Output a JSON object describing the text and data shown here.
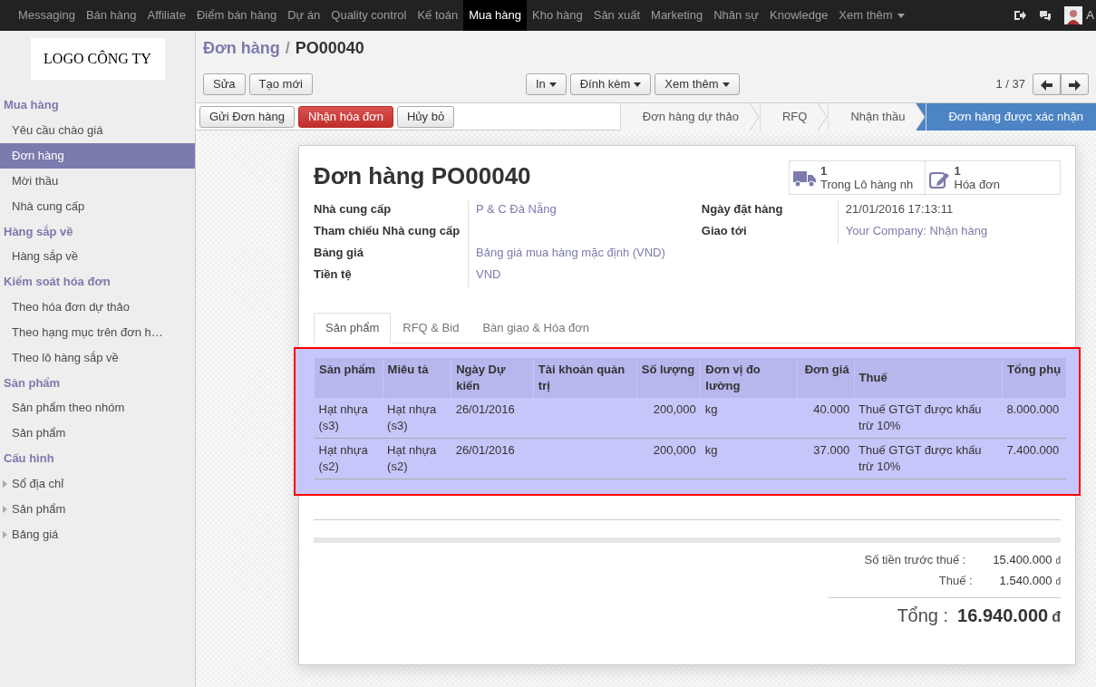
{
  "topbar": {
    "apps": [
      {
        "label": "Messaging",
        "selected": false
      },
      {
        "label": "Bán hàng",
        "selected": false
      },
      {
        "label": "Affiliate",
        "selected": false
      },
      {
        "label": "Điểm bán hàng",
        "selected": false
      },
      {
        "label": "Dự án",
        "selected": false
      },
      {
        "label": "Quality control",
        "selected": false
      },
      {
        "label": "Kế toán",
        "selected": false
      },
      {
        "label": "Mua hàng",
        "selected": true
      },
      {
        "label": "Kho hàng",
        "selected": false
      },
      {
        "label": "Sản xuất",
        "selected": false
      },
      {
        "label": "Marketing",
        "selected": false
      },
      {
        "label": "Nhân sự",
        "selected": false
      },
      {
        "label": "Knowledge",
        "selected": false
      }
    ],
    "more": "Xem thêm",
    "user": "A"
  },
  "logo": "LOGO CÔNG TY",
  "sidebar": [
    {
      "title": "Mua hàng",
      "items": [
        {
          "label": "Yêu cầu chào giá",
          "selected": false,
          "kind": "link"
        },
        {
          "label": "Đơn hàng",
          "selected": true,
          "kind": "link"
        },
        {
          "label": "Mời thầu",
          "selected": false,
          "kind": "link"
        },
        {
          "label": "Nhà cung cấp",
          "selected": false,
          "kind": "link"
        }
      ]
    },
    {
      "title": "Hàng sắp về",
      "items": [
        {
          "label": "Hàng sắp về",
          "selected": false,
          "kind": "link"
        }
      ]
    },
    {
      "title": "Kiểm soát hóa đơn",
      "items": [
        {
          "label": "Theo hóa đơn dự thảo",
          "selected": false,
          "kind": "link"
        },
        {
          "label": "Theo hạng mục trên đơn h…",
          "selected": false,
          "kind": "link"
        },
        {
          "label": "Theo lô hàng sắp về",
          "selected": false,
          "kind": "link"
        }
      ]
    },
    {
      "title": "Sản phẩm",
      "items": [
        {
          "label": "Sản phẩm theo nhóm",
          "selected": false,
          "kind": "link"
        },
        {
          "label": "Sản phẩm",
          "selected": false,
          "kind": "link"
        }
      ]
    },
    {
      "title": "Cấu hình",
      "items": [
        {
          "label": "Sổ địa chỉ",
          "selected": false,
          "kind": "folder"
        },
        {
          "label": "Sản phẩm",
          "selected": false,
          "kind": "folder"
        },
        {
          "label": "Bảng giá",
          "selected": false,
          "kind": "folder"
        }
      ]
    }
  ],
  "breadcrumb": {
    "parent": "Đơn hàng",
    "separator": "/",
    "current": "PO00040"
  },
  "buttons": [
    "Sửa",
    "Tạo mới"
  ],
  "dropdowns": [
    "In",
    "Đính kèm",
    "Xem thêm"
  ],
  "pager": "1 / 37",
  "actions": [
    {
      "label": "Gửi Đơn hàng",
      "kind": "default"
    },
    {
      "label": "Nhận hóa đơn",
      "kind": "primary"
    },
    {
      "label": "Hủy bỏ",
      "kind": "default"
    }
  ],
  "stages": [
    {
      "label": "Đơn hàng dự thảo",
      "selected": false
    },
    {
      "label": "RFQ",
      "selected": false
    },
    {
      "label": "Nhận thầu",
      "selected": false
    },
    {
      "label": "Đơn hàng được xác nhận",
      "selected": true
    }
  ],
  "form": {
    "title": "Đơn hàng PO00040",
    "smart_buttons": [
      {
        "count": "1",
        "label": "Trong Lô hàng nh",
        "kind": "truck"
      },
      {
        "count": "1",
        "label": "Hóa đơn",
        "kind": "edit"
      }
    ],
    "left_fields": [
      {
        "label": "Nhà cung cấp",
        "value": "P & C Đà Nẵng",
        "link": true
      },
      {
        "label": "Tham chiếu Nhà cung cấp"
      },
      {
        "label": "Bảng giá",
        "value": "Bảng giá mua hàng mặc định (VND)",
        "link": true
      },
      {
        "label": "Tiền tệ",
        "value": "VND",
        "link": true
      }
    ],
    "right_fields": [
      {
        "label": "Ngày đặt hàng",
        "value": "21/01/2016 17:13:11",
        "link": false
      },
      {
        "label": "Giao tới",
        "value": "Your Company: Nhận hàng",
        "link": true
      }
    ],
    "tabs": [
      {
        "label": "Sản phẩm",
        "selected": true
      },
      {
        "label": "RFQ & Bid",
        "selected": false
      },
      {
        "label": "Bàn giao & Hóa đơn",
        "selected": false
      }
    ],
    "table": {
      "columns": [
        "Sản phẩm",
        "Miêu tả",
        "Ngày Dự kiến",
        "Tài khoản quản trị",
        "Số lượng",
        "Đơn vị đo lường",
        "Đơn giá",
        "Thuế",
        "Tổng phụ"
      ],
      "rows": [
        [
          "Hạt nhựa (s3)",
          "Hạt nhựa (s3)",
          "26/01/2016",
          "",
          "200,000",
          "kg",
          "40.000",
          "Thuế GTGT được khấu trừ 10%",
          "8.000.000"
        ],
        [
          "Hạt nhựa (s2)",
          "Hạt nhựa (s2)",
          "26/01/2016",
          "",
          "200,000",
          "kg",
          "37.000",
          "Thuế GTGT được khấu trừ 10%",
          "7.400.000"
        ]
      ]
    },
    "totals": [
      {
        "label": "Số tiền trước thuế :",
        "value": "15.400.000",
        "currency": "đ",
        "kind": "line"
      },
      {
        "label": "Thuế :",
        "value": "1.540.000",
        "currency": "đ",
        "kind": "line"
      },
      {
        "label": "Tổng :",
        "value": "16.940.000",
        "currency": "đ",
        "kind": "grand"
      }
    ]
  }
}
